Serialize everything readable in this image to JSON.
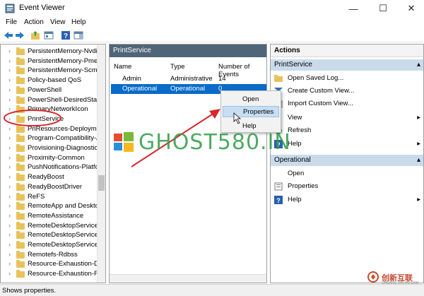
{
  "window": {
    "title": "Event Viewer",
    "minimize": "—",
    "maximize": "☐",
    "close": "✕"
  },
  "menu": [
    "File",
    "Action",
    "View",
    "Help"
  ],
  "tree": {
    "items": [
      "PersistentMemory-Nvdimm",
      "PersistentMemory-PmemDisk",
      "PersistentMemory-ScmBus",
      "Policy-based QoS",
      "PowerShell",
      "PowerShell-DesiredStateConfiguration",
      "PrimaryNetworkIcon",
      "PrintService",
      "PriResources-Deployment",
      "Program-Compatibility-Assistant",
      "Provisioning-Diagnostics",
      "Proximity-Common",
      "PushNotifications-Platform",
      "ReadyBoost",
      "ReadyBoostDriver",
      "ReFS",
      "RemoteApp and Desktop",
      "RemoteAssistance",
      "RemoteDesktopServices-",
      "RemoteDesktopServices-",
      "RemoteDesktopServices-",
      "Remotefs-Rdbss",
      "Resource-Exhaustion-De",
      "Resource-Exhaustion-Re"
    ]
  },
  "middle": {
    "title": "PrintService",
    "columns": [
      "Name",
      "Type",
      "Number of Events"
    ],
    "rows": [
      {
        "name": "Admin",
        "type": "Administrative",
        "count": "14"
      },
      {
        "name": "Operational",
        "type": "Operational",
        "count": "0"
      }
    ]
  },
  "actions": {
    "title": "Actions",
    "group1": {
      "label": "PrintService",
      "arrow": "▴"
    },
    "group1_items": [
      {
        "label": "Open Saved Log...",
        "icon": "open-folder-icon",
        "arrow": ""
      },
      {
        "label": "Create Custom View...",
        "icon": "filter-icon",
        "arrow": ""
      },
      {
        "label": "Import Custom View...",
        "icon": "import-icon",
        "arrow": ""
      },
      {
        "label": "View",
        "icon": "",
        "arrow": "▸"
      },
      {
        "label": "Refresh",
        "icon": "refresh-icon",
        "arrow": ""
      },
      {
        "label": "Help",
        "icon": "help-icon",
        "arrow": "▸"
      }
    ],
    "group2": {
      "label": "Operational",
      "arrow": "▴"
    },
    "group2_items": [
      {
        "label": "Open",
        "icon": "",
        "arrow": ""
      },
      {
        "label": "Properties",
        "icon": "properties-icon",
        "arrow": ""
      },
      {
        "label": "Help",
        "icon": "help-icon",
        "arrow": "▸"
      }
    ]
  },
  "context_menu": {
    "items": [
      "Open",
      "Properties",
      "Help"
    ],
    "highlighted": "Properties"
  },
  "status": "Shows properties.",
  "watermark": {
    "text": "GHOST580.IN",
    "brand": "创新互联",
    "brand_sub": "CHUANG XIN HU LIAN"
  },
  "colors": {
    "header": "#4f6578",
    "selection": "#0a6bc8",
    "group": "#c9dbeb",
    "annotation": "#d9262b",
    "watermark": "#2e9b46"
  }
}
